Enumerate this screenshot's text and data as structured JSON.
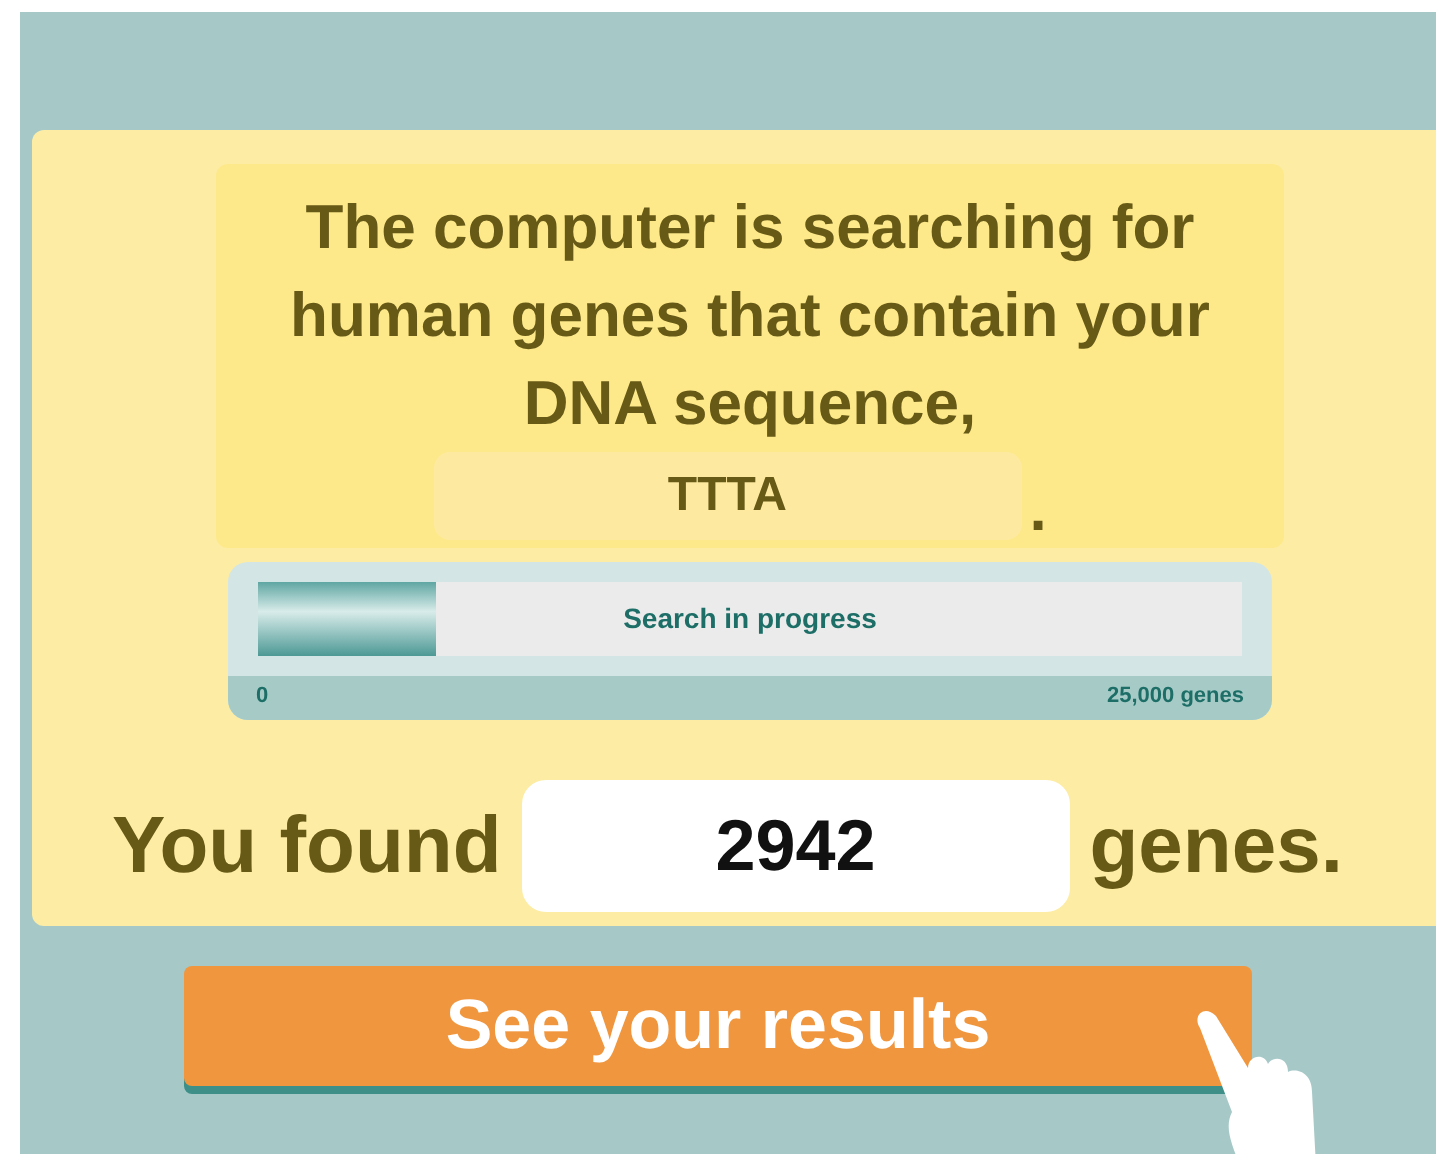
{
  "headline": "The computer is searching for human genes that contain your DNA sequence,",
  "sequence": "TTTA",
  "sequence_end": ".",
  "progress": {
    "label": "Search in progress",
    "level": 0.18,
    "min_label": "0",
    "max_label": "25,000 genes"
  },
  "result": {
    "prefix": "You found",
    "count": "2942",
    "suffix": "genes."
  },
  "button": "See your results"
}
